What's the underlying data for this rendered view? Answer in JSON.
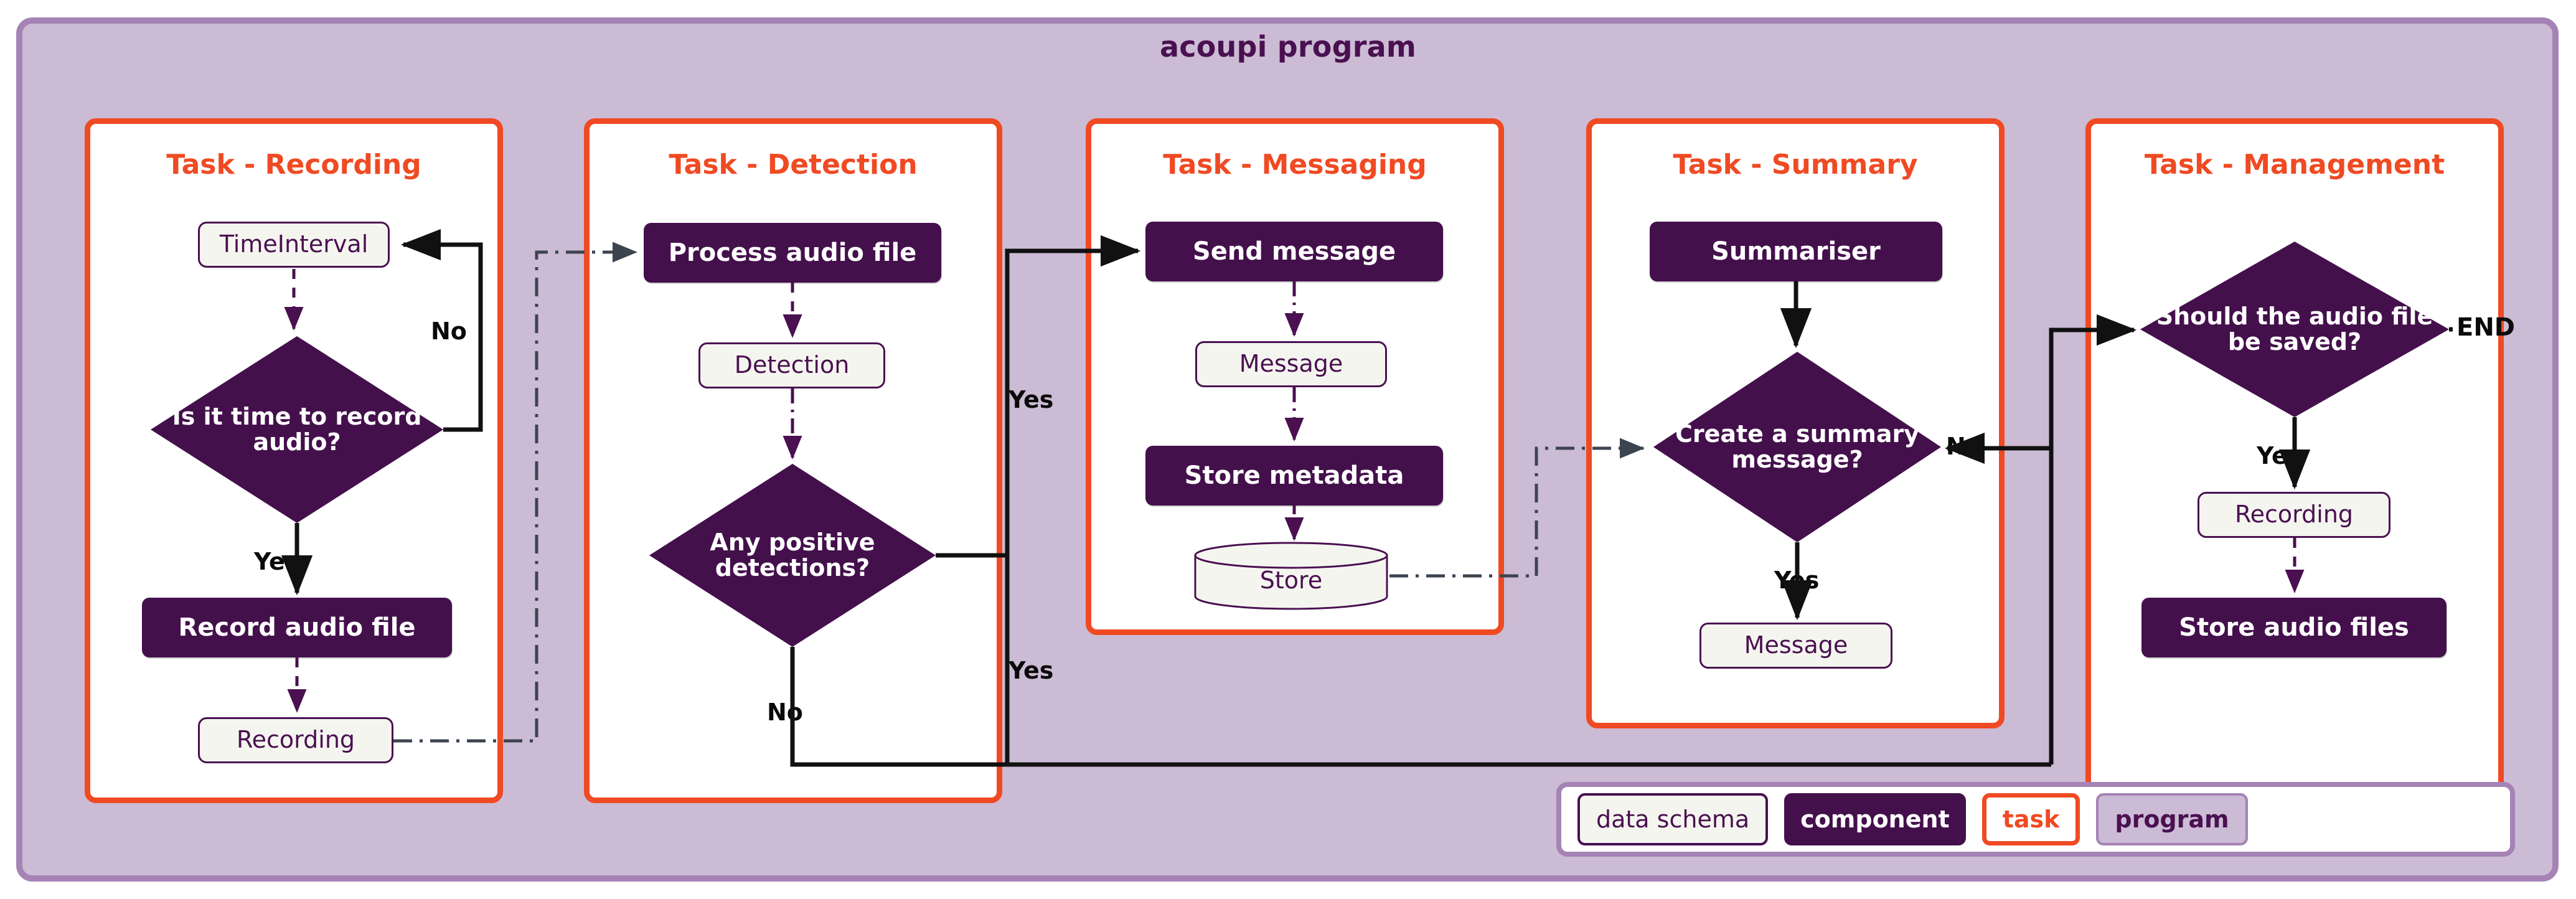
{
  "program": {
    "title": "acoupi program"
  },
  "tasks": [
    {
      "id": "recording",
      "title": "Task - Recording",
      "nodes": {
        "time_interval": "TimeInterval",
        "decision": "Is it time to record audio?",
        "record": "Record audio file",
        "recording": "Recording"
      },
      "labels": {
        "no": "No",
        "yes": "Yes"
      }
    },
    {
      "id": "detection",
      "title": "Task - Detection",
      "nodes": {
        "process": "Process audio file",
        "detection": "Detection",
        "decision": "Any positive detections?"
      },
      "labels": {
        "no": "No",
        "yes_top": "Yes",
        "yes_bottom": "Yes"
      }
    },
    {
      "id": "messaging",
      "title": "Task - Messaging",
      "nodes": {
        "send": "Send message",
        "message": "Message",
        "store_metadata": "Store metadata",
        "store": "Store"
      }
    },
    {
      "id": "summary",
      "title": "Task - Summary",
      "nodes": {
        "summariser": "Summariser",
        "decision": "Create a summary message?",
        "message": "Message"
      },
      "labels": {
        "no": "No",
        "yes": "Yes"
      }
    },
    {
      "id": "management",
      "title": "Task - Management",
      "nodes": {
        "decision": "Should the audio file be saved?",
        "recording": "Recording",
        "store_audio": "Store audio files"
      },
      "labels": {
        "end": "END",
        "yes": "Yes"
      }
    }
  ],
  "legend": {
    "items": [
      {
        "key": "data_schema",
        "label": "data schema"
      },
      {
        "key": "component",
        "label": "component"
      },
      {
        "key": "task",
        "label": "task"
      },
      {
        "key": "program",
        "label": "program"
      }
    ]
  },
  "colors": {
    "program_fill": "#CBBBD4",
    "program_border": "#A583B5",
    "task_border": "#F04A23",
    "task_title": "#F04A23",
    "component_fill": "#44104C",
    "schema_fill": "#F5F5F0",
    "schema_text": "#4A1050",
    "edge": "#111111",
    "data_edge": "#3C4450"
  }
}
